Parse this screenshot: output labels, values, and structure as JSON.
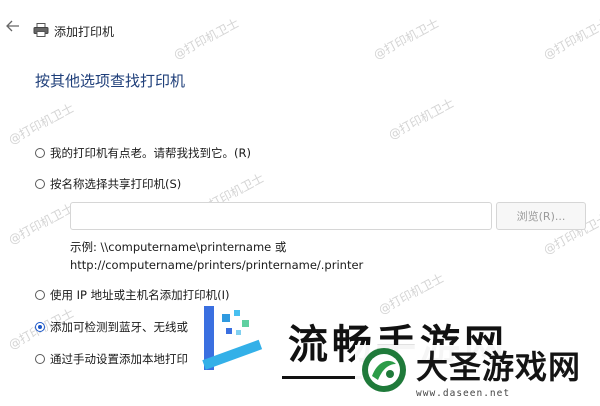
{
  "window": {
    "title": "添加打印机"
  },
  "heading": "按其他选项查找打印机",
  "options": [
    {
      "label": "我的打印机有点老。请帮我找到它。(R)",
      "checked": false
    },
    {
      "label": "按名称选择共享打印机(S)",
      "checked": false
    },
    {
      "label": "使用 IP 地址或主机名添加打印机(I)",
      "checked": false
    },
    {
      "label": "添加可检测到蓝牙、无线或",
      "checked": true
    },
    {
      "label": "通过手动设置添加本地打印",
      "checked": false
    }
  ],
  "share": {
    "input_value": "",
    "browse_label": "浏览(R)...",
    "example_line1": "示例: \\\\computername\\printername 或",
    "example_line2": "http://computername/printers/printername/.printer"
  },
  "watermark": "@打印机卫士",
  "overlay": {
    "text": "流畅手游网",
    "site_title": "大圣游戏网",
    "site_url": "www.daseen.net"
  },
  "colors": {
    "heading": "#1f3f7a",
    "accent": "#1a56c8"
  }
}
